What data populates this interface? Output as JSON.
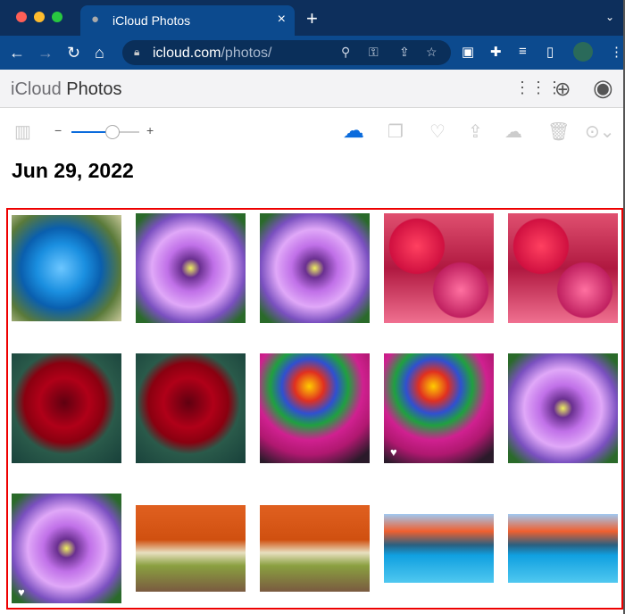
{
  "browser": {
    "tab_title": "iCloud Photos",
    "url_host": "icloud.com",
    "url_path": "/photos/",
    "new_tab": "+",
    "close": "×"
  },
  "app": {
    "brand": "iCloud",
    "title": "Photos"
  },
  "section": {
    "date": "Jun 29, 2022"
  },
  "zoom_slider": {
    "value_percent": 60,
    "minus": "−",
    "plus": "+"
  },
  "colors": {
    "accent": "#0a6bdc",
    "selection_frame": "#ee0000"
  },
  "photos": [
    {
      "kind": "blue-rose",
      "favorite": false
    },
    {
      "kind": "purple-dahlia",
      "favorite": false
    },
    {
      "kind": "purple-dahlia",
      "favorite": false
    },
    {
      "kind": "dahlia-field",
      "favorite": false
    },
    {
      "kind": "dahlia-field",
      "favorite": false
    },
    {
      "kind": "red-rose",
      "favorite": false
    },
    {
      "kind": "red-rose",
      "favorite": false
    },
    {
      "kind": "rainbow-rose",
      "favorite": false
    },
    {
      "kind": "rainbow-rose",
      "favorite": true
    },
    {
      "kind": "purple-dahlia",
      "favorite": false
    },
    {
      "kind": "purple-dahlia",
      "favorite": true
    },
    {
      "kind": "autumn-tree",
      "favorite": false
    },
    {
      "kind": "autumn-tree",
      "favorite": false
    },
    {
      "kind": "mountain-lake",
      "favorite": false
    },
    {
      "kind": "mountain-lake",
      "favorite": false
    }
  ]
}
